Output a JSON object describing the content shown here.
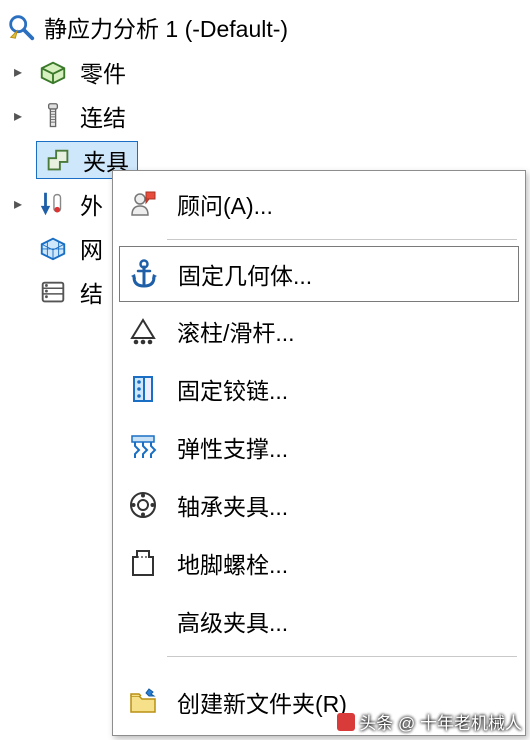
{
  "root": {
    "title": "静应力分析 1 (-Default-)"
  },
  "tree": {
    "parts": "零件",
    "connections": "连结",
    "fixtures": "夹具",
    "external": "外",
    "mesh": "网",
    "results": "结"
  },
  "menu": {
    "advisor": "顾问(A)...",
    "fixed_geometry": "固定几何体...",
    "roller_slider": "滚柱/滑杆...",
    "fixed_hinge": "固定铰链...",
    "elastic_support": "弹性支撑...",
    "bearing_fixture": "轴承夹具...",
    "foundation_bolt": "地脚螺栓...",
    "advanced_fixtures": "高级夹具...",
    "create_new_folder": "创建新文件夹(R)"
  },
  "watermark": "头条 @ 十年老机械人"
}
